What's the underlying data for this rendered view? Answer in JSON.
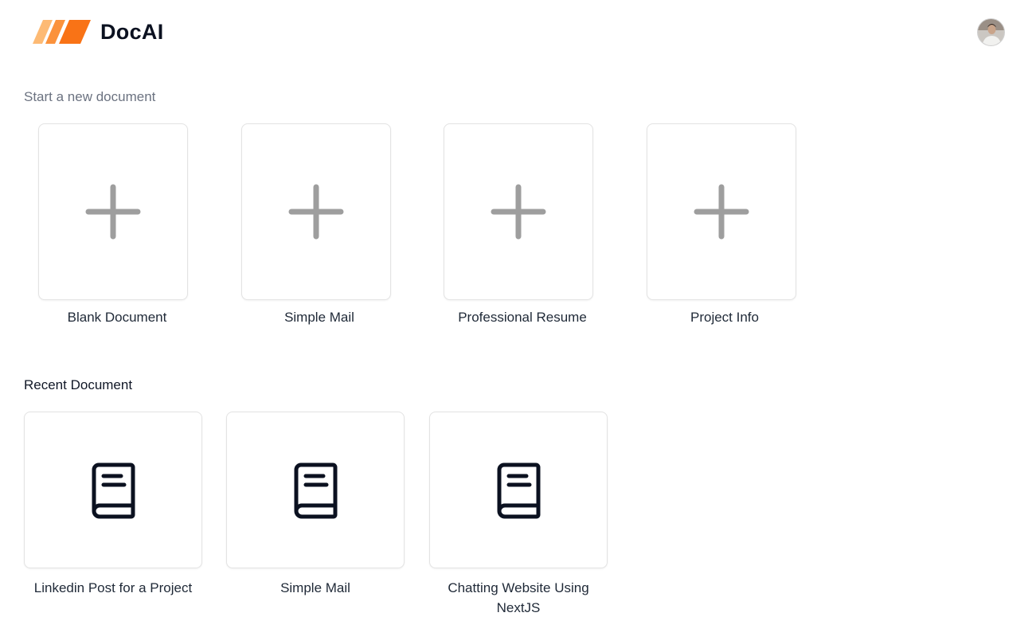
{
  "header": {
    "brand": "DocAI",
    "logo_icon": "docai-logo-icon",
    "avatar_icon": "user-avatar-icon",
    "colors": {
      "logo_light": "#fdba74",
      "logo_dark": "#f97316"
    }
  },
  "templates": {
    "title": "Start a new document",
    "icon": "plus-icon",
    "items": [
      {
        "label": "Blank Document"
      },
      {
        "label": "Simple Mail"
      },
      {
        "label": "Professional Resume"
      },
      {
        "label": "Project Info"
      }
    ]
  },
  "recent": {
    "title": "Recent Document",
    "icon": "book-icon",
    "items": [
      {
        "label": "Linkedin Post for a Project"
      },
      {
        "label": "Simple Mail"
      },
      {
        "label": "Chatting Website Using NextJS"
      }
    ]
  }
}
